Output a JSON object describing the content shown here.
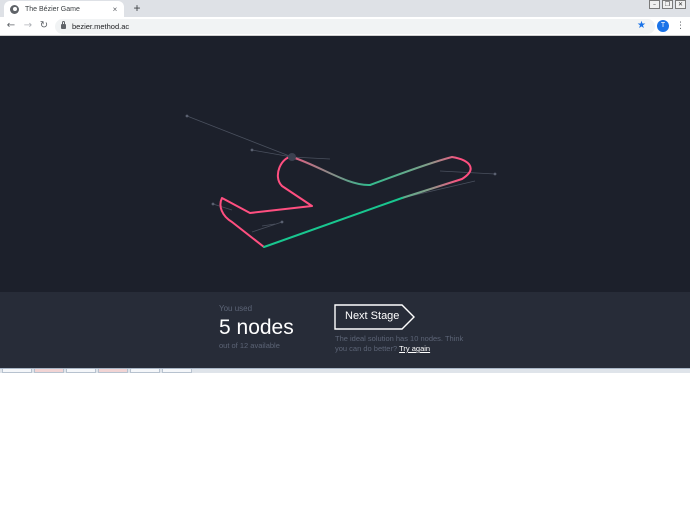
{
  "browser": {
    "tab_title": "The Bézier Game",
    "tab_close": "×",
    "new_tab": "+",
    "url": "bezier.method.ac",
    "profile_initial": "T",
    "window_controls": [
      "–",
      "❐",
      "✕"
    ]
  },
  "icons": {
    "back": "arrow-left-icon",
    "forward": "arrow-right-icon",
    "reload": "reload-icon",
    "lock": "lock-icon",
    "bookmark": "star-icon",
    "menu": "more-vertical-icon"
  },
  "colors": {
    "canvas_bg": "#1c202b",
    "panel_bg": "#272c38",
    "path_pink": "#ff4f80",
    "path_green": "#19c68f"
  },
  "results": {
    "used_label": "You used",
    "count_text": "5 nodes",
    "available_text": "out of 12 available",
    "next_button": "Next Stage",
    "hint_text": "The ideal solution has 10 nodes. Think you can do better?",
    "try_again": "Try again"
  }
}
